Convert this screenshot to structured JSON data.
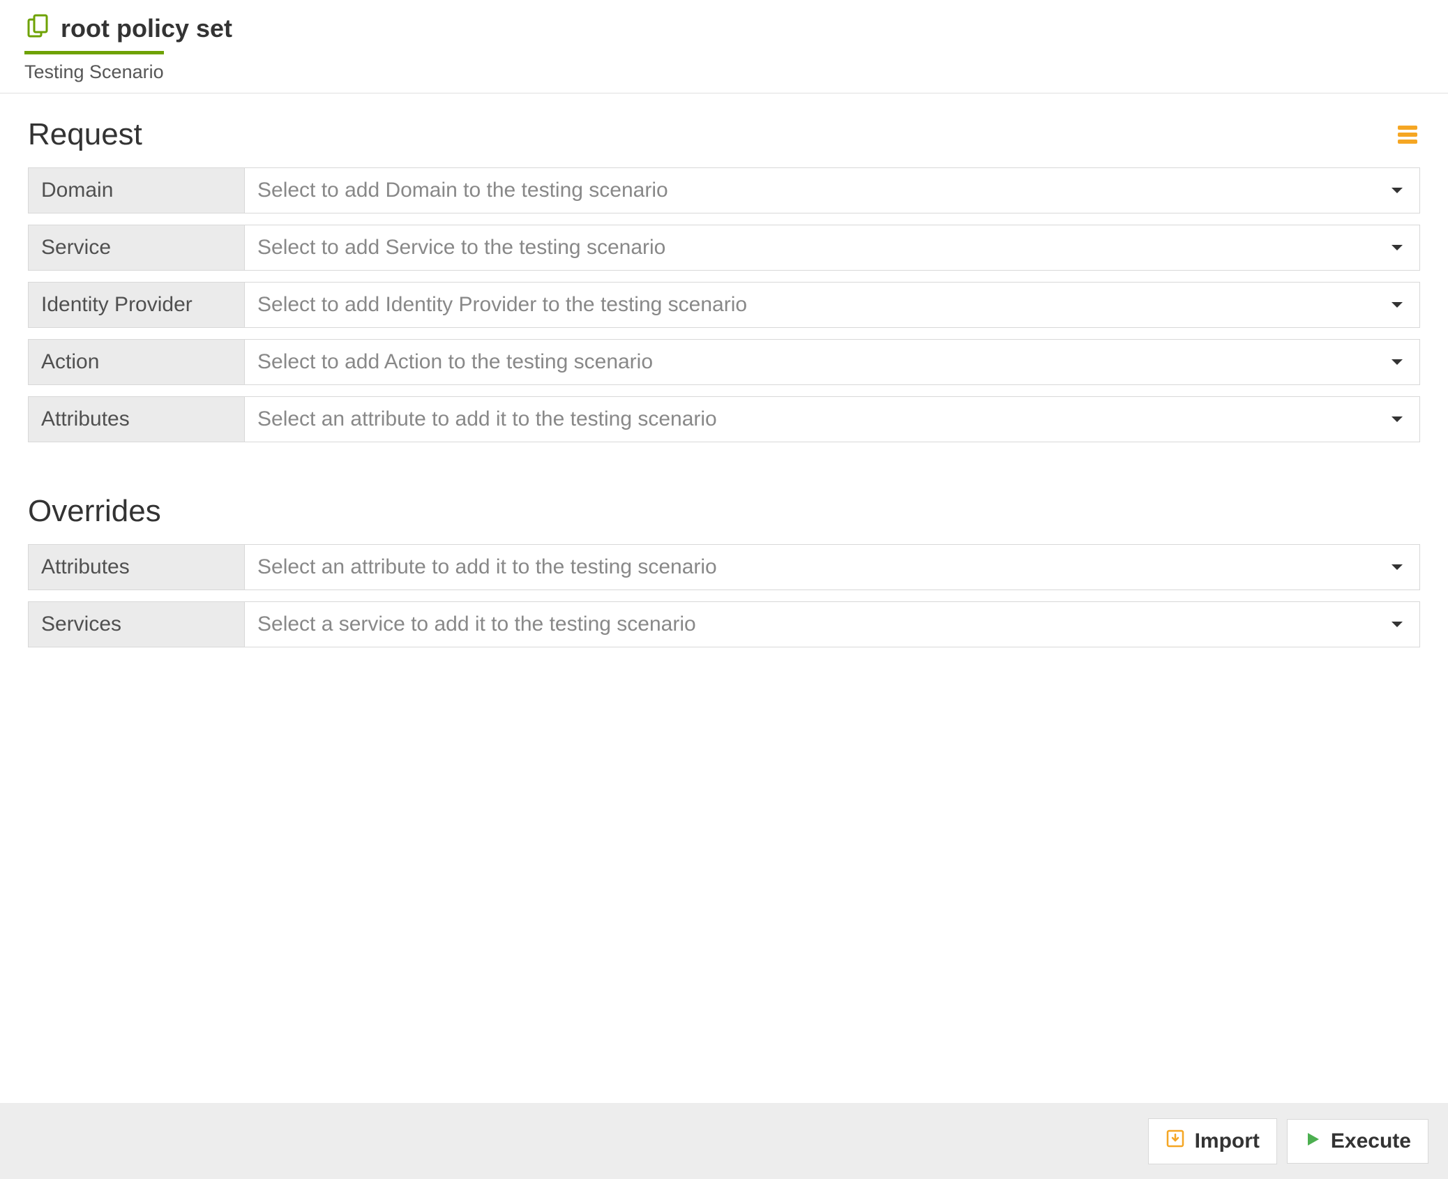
{
  "header": {
    "title": "root policy set",
    "tab": "Testing Scenario"
  },
  "sections": {
    "request": {
      "title": "Request",
      "rows": [
        {
          "label": "Domain",
          "placeholder": "Select to add Domain to the testing scenario"
        },
        {
          "label": "Service",
          "placeholder": "Select to add Service to the testing scenario"
        },
        {
          "label": "Identity Provider",
          "placeholder": "Select to add Identity Provider to the testing scenario"
        },
        {
          "label": "Action",
          "placeholder": "Select to add Action to the testing scenario"
        },
        {
          "label": "Attributes",
          "placeholder": "Select an attribute to add it to the testing scenario"
        }
      ]
    },
    "overrides": {
      "title": "Overrides",
      "rows": [
        {
          "label": "Attributes",
          "placeholder": "Select an attribute to add it to the testing scenario"
        },
        {
          "label": "Services",
          "placeholder": "Select a service to add it to the testing scenario"
        }
      ]
    }
  },
  "footer": {
    "import": "Import",
    "execute": "Execute"
  }
}
